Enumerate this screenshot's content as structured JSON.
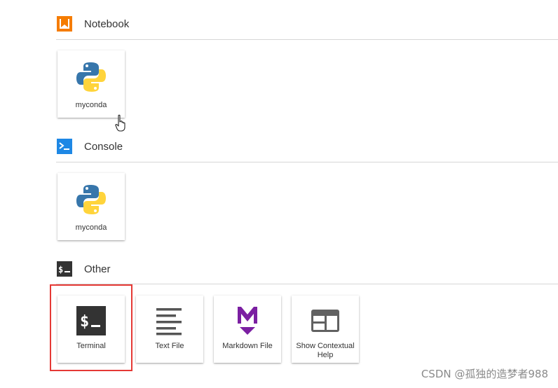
{
  "sections": {
    "notebook": {
      "title": "Notebook",
      "icon": "notebook-icon",
      "icon_color": "#f57c00",
      "cards": [
        {
          "label": "myconda",
          "icon": "python-logo-icon"
        }
      ]
    },
    "console": {
      "title": "Console",
      "icon": "console-icon",
      "icon_color": "#1e88e5",
      "cards": [
        {
          "label": "myconda",
          "icon": "python-logo-icon"
        }
      ]
    },
    "other": {
      "title": "Other",
      "icon": "terminal-icon",
      "icon_color": "#333333",
      "cards": [
        {
          "label": "Terminal",
          "icon": "terminal-icon"
        },
        {
          "label": "Text File",
          "icon": "text-file-icon"
        },
        {
          "label": "Markdown File",
          "icon": "markdown-icon"
        },
        {
          "label": "Show Contextual Help",
          "icon": "contextual-help-icon"
        }
      ]
    }
  },
  "highlight": {
    "target": "Terminal",
    "color": "#e53935"
  },
  "watermark": "CSDN @孤独的造梦者988",
  "colors": {
    "python_blue": "#3776ab",
    "python_yellow": "#ffd43b",
    "markdown_purple": "#7b1fa2",
    "divider": "#d6d6d6"
  }
}
